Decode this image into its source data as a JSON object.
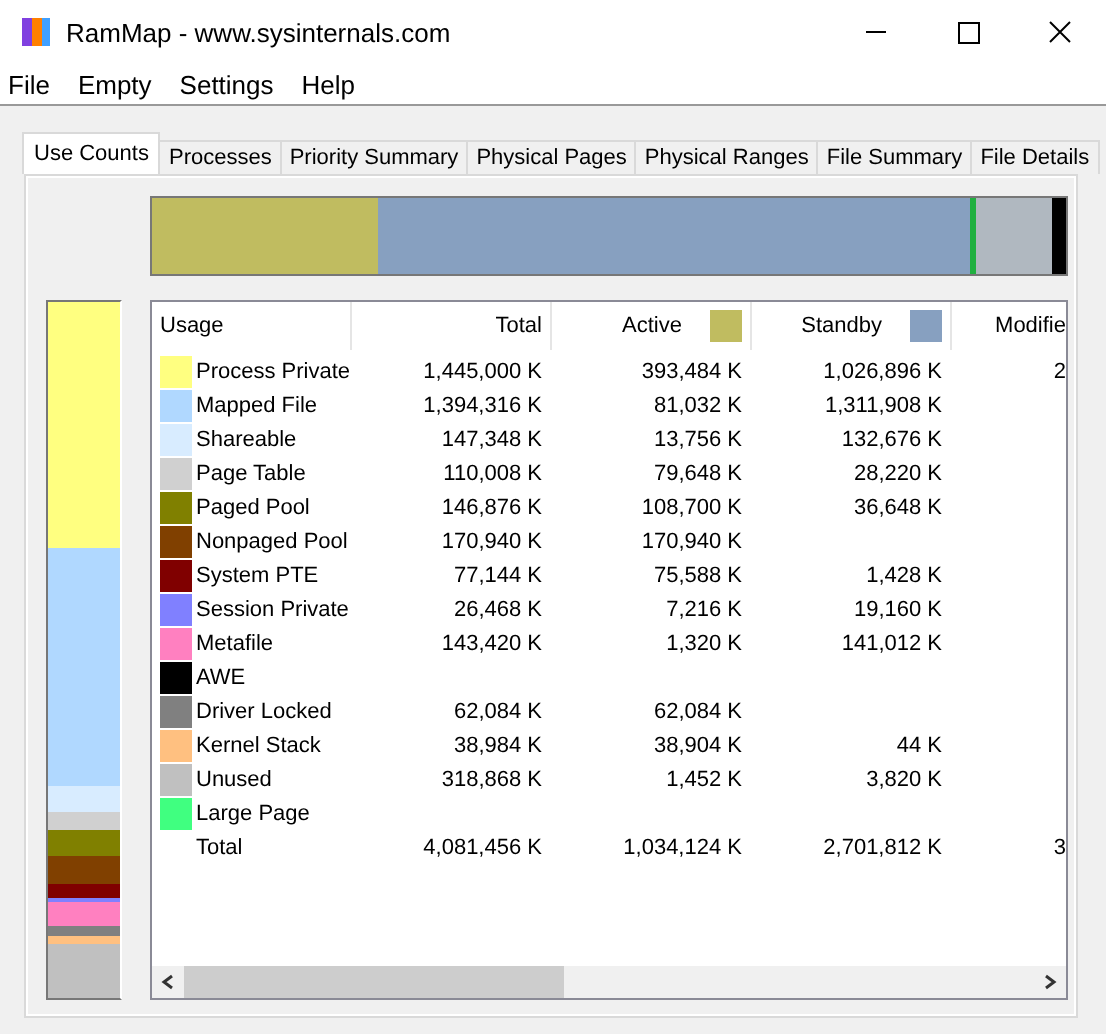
{
  "window": {
    "title": "RamMap - www.sysinternals.com"
  },
  "menu": [
    "File",
    "Empty",
    "Settings",
    "Help"
  ],
  "tabs": [
    {
      "label": "Use Counts",
      "selected": true
    },
    {
      "label": "Processes",
      "selected": false
    },
    {
      "label": "Priority Summary",
      "selected": false
    },
    {
      "label": "Physical Pages",
      "selected": false
    },
    {
      "label": "Physical Ranges",
      "selected": false
    },
    {
      "label": "File Summary",
      "selected": false
    },
    {
      "label": "File Details",
      "selected": false
    }
  ],
  "table": {
    "columns": [
      {
        "label": "Usage"
      },
      {
        "label": "Total"
      },
      {
        "label": "Active",
        "color": "#c0bc60"
      },
      {
        "label": "Standby",
        "color": "#87a0c0"
      },
      {
        "label": "Modifie"
      }
    ],
    "rows": [
      {
        "usage": "Process Private",
        "color": "#ffff80",
        "total": "1,445,000 K",
        "active": "393,484 K",
        "standby": "1,026,896 K",
        "column_5": "2"
      },
      {
        "usage": "Mapped File",
        "color": "#b0d8ff",
        "total": "1,394,316 K",
        "active": "81,032 K",
        "standby": "1,311,908 K"
      },
      {
        "usage": "Shareable",
        "color": "#d8ecff",
        "total": "147,348 K",
        "active": "13,756 K",
        "standby": "132,676 K"
      },
      {
        "usage": "Page Table",
        "color": "#d0d0d0",
        "total": "110,008 K",
        "active": "79,648 K",
        "standby": "28,220 K"
      },
      {
        "usage": "Paged Pool",
        "color": "#808000",
        "total": "146,876 K",
        "active": "108,700 K",
        "standby": "36,648 K"
      },
      {
        "usage": "Nonpaged Pool",
        "color": "#804000",
        "total": "170,940 K",
        "active": "170,940 K"
      },
      {
        "usage": "System PTE",
        "color": "#800000",
        "total": "77,144 K",
        "active": "75,588 K",
        "standby": "1,428 K"
      },
      {
        "usage": "Session Private",
        "color": "#8080ff",
        "total": "26,468 K",
        "active": "7,216 K",
        "standby": "19,160 K"
      },
      {
        "usage": "Metafile",
        "color": "#ff80c0",
        "total": "143,420 K",
        "active": "1,320 K",
        "standby": "141,012 K"
      },
      {
        "usage": "AWE",
        "color": "#000000"
      },
      {
        "usage": "Driver Locked",
        "color": "#808080",
        "total": "62,084 K",
        "active": "62,084 K"
      },
      {
        "usage": "Kernel Stack",
        "color": "#ffc080",
        "total": "38,984 K",
        "active": "38,904 K",
        "standby": "44 K"
      },
      {
        "usage": "Unused",
        "color": "#c0c0c0",
        "total": "318,868 K",
        "active": "1,452 K",
        "standby": "3,820 K"
      },
      {
        "usage": "Large Page",
        "color": "#40ff80"
      },
      {
        "usage": "Total",
        "total": "4,081,456 K",
        "active": "1,034,124 K",
        "standby": "2,701,812 K",
        "column_5": "3"
      }
    ]
  }
}
